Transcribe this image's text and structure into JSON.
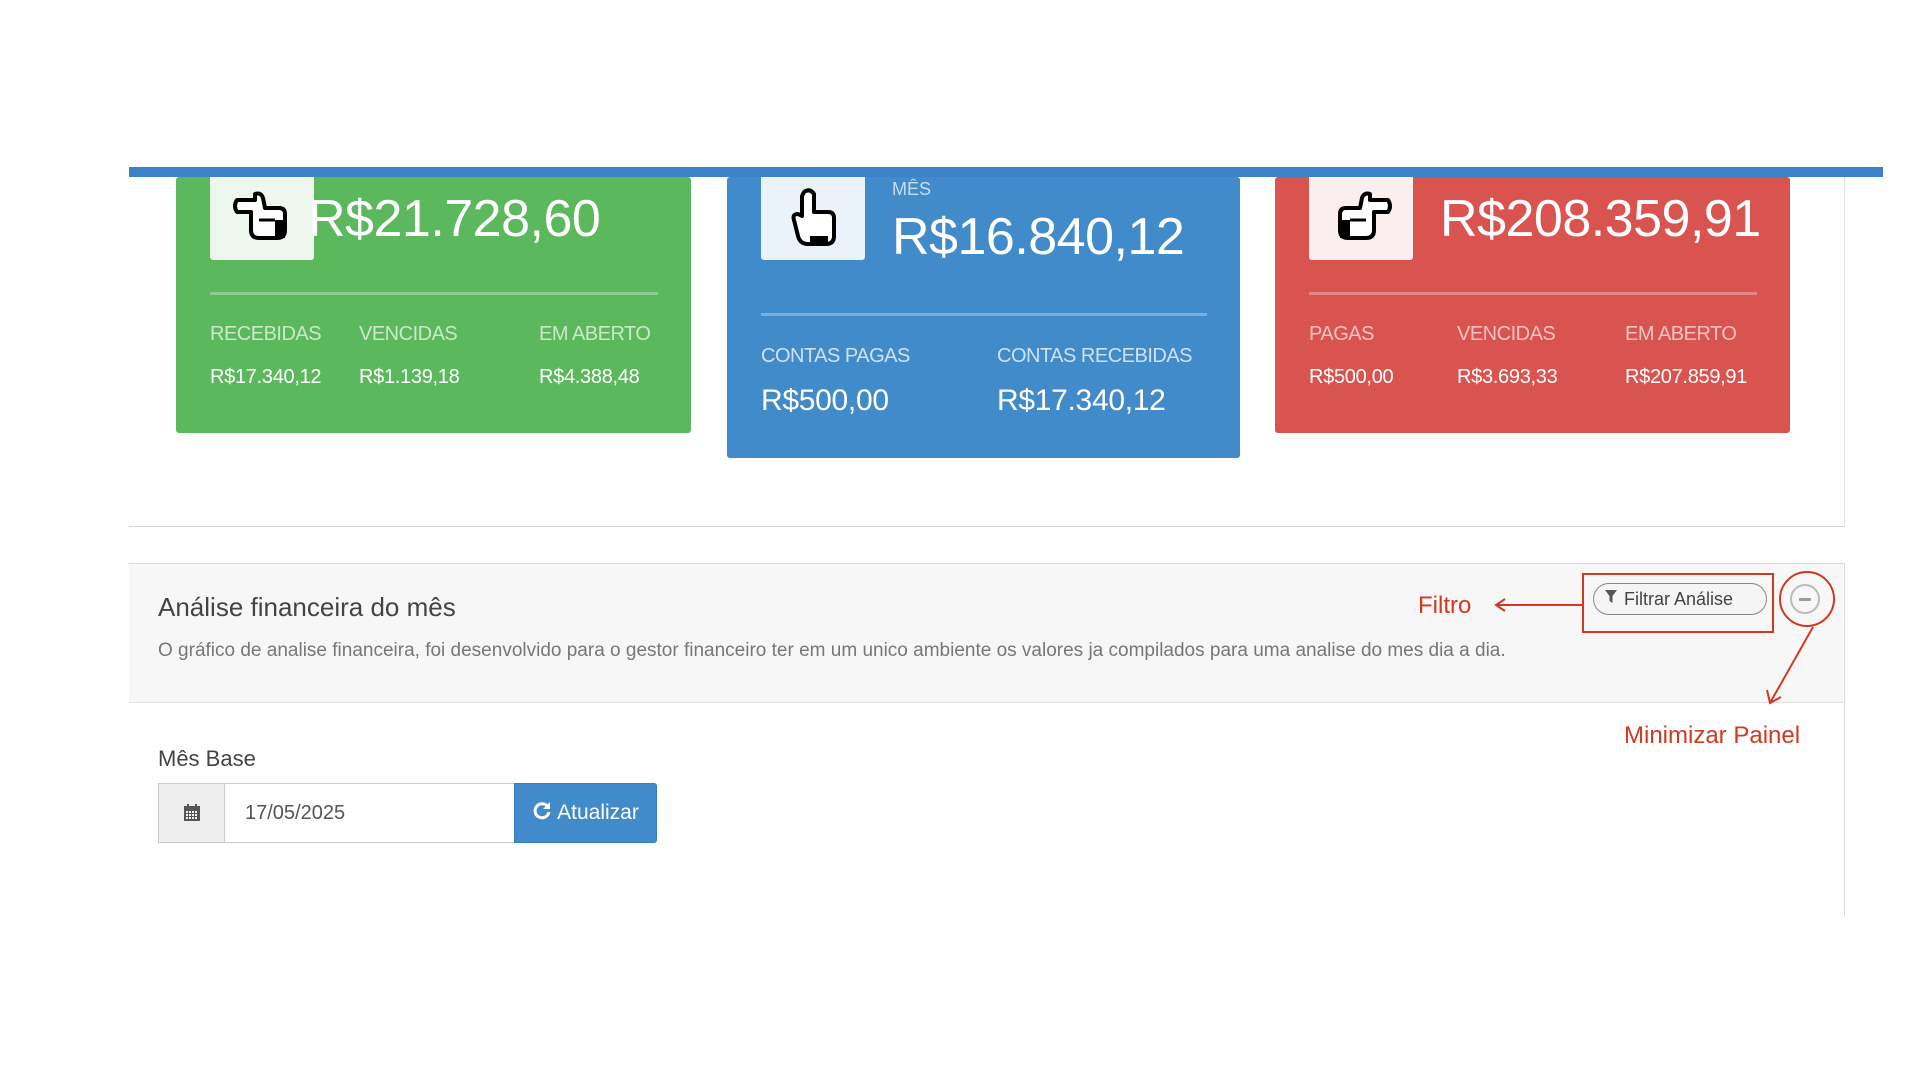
{
  "cards": {
    "receber": {
      "icon": "hand-pointing-left-icon",
      "total": "R$21.728,60",
      "cols": [
        {
          "label": "RECEBIDAS",
          "value": "R$17.340,12"
        },
        {
          "label": "VENCIDAS",
          "value": "R$1.139,18"
        },
        {
          "label": "EM ABERTO",
          "value": "R$4.388,48"
        }
      ]
    },
    "mes": {
      "icon": "hand-pointing-down-icon",
      "title": "MÊS",
      "total": "R$16.840,12",
      "cols": [
        {
          "label": "CONTAS PAGAS",
          "value": "R$500,00"
        },
        {
          "label": "CONTAS RECEBIDAS",
          "value": "R$17.340,12"
        }
      ]
    },
    "pagar": {
      "icon": "hand-pointing-right-icon",
      "total": "R$208.359,91",
      "cols": [
        {
          "label": "PAGAS",
          "value": "R$500,00"
        },
        {
          "label": "VENCIDAS",
          "value": "R$3.693,33"
        },
        {
          "label": "EM ABERTO",
          "value": "R$207.859,91"
        }
      ]
    }
  },
  "analise": {
    "title": "Análise financeira do mês",
    "description": "O gráfico de analise financeira, foi desenvolvido para o gestor financeiro ter em um unico ambiente os valores ja compilados para uma analise do mes dia a dia.",
    "filter_button": "Filtrar Análise",
    "minimize_icon": "minus-circle-icon",
    "mes_base_label": "Mês Base",
    "date_value": "17/05/2025",
    "calendar_icon": "calendar-icon",
    "refresh_icon": "refresh-icon",
    "refresh_button": "Atualizar"
  },
  "annotations": {
    "filtro": "Filtro",
    "minimizar": "Minimizar Painel"
  },
  "colors": {
    "green": "#5cb85c",
    "blue": "#428bca",
    "red": "#d9534f",
    "annotation": "#d0391f"
  }
}
